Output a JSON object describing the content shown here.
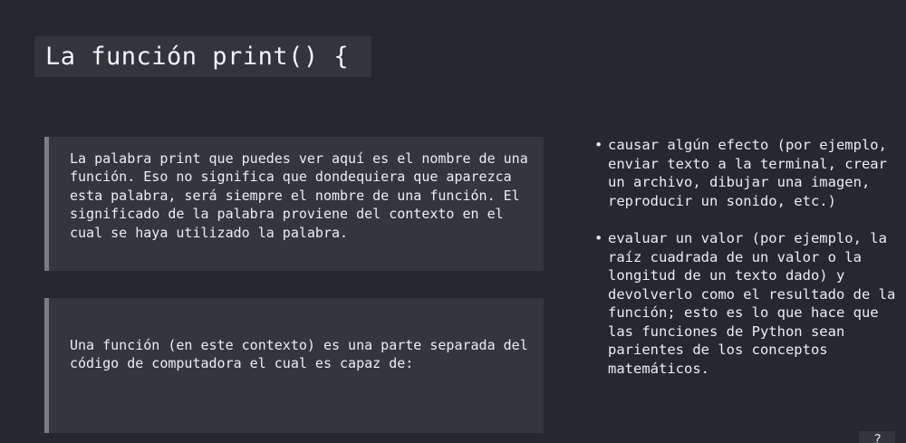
{
  "slide": {
    "title": "La función print() {",
    "paragraph_1": "La palabra print que puedes ver aquí es el nombre de una función. Eso no significa que dondequiera que aparezca esta palabra, será siempre el nombre de una función. El significado de la palabra proviene del contexto en el cual se haya utilizado la palabra.",
    "paragraph_2": "Una función (en este contexto) es una parte separada del código de computadora el cual es capaz de:",
    "bullet_glyph": "•",
    "bullets": [
      "causar algún efecto (por ejemplo, enviar texto a la terminal, crear un archivo, dibujar una imagen, reproducir un sonido, etc.)",
      "evaluar un valor (por ejemplo, la raíz cuadrada de un valor o la longitud de un texto dado) y devolverlo como el resultado de la función; esto es lo que hace que las funciones de Python sean parientes de los conceptos matemáticos."
    ]
  },
  "corner_control": {
    "glyph": "?"
  }
}
